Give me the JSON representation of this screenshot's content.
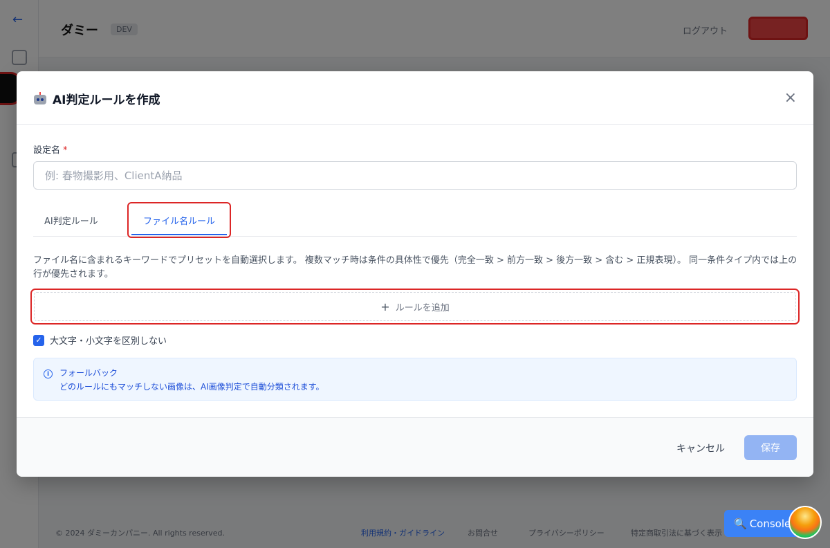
{
  "background": {
    "back_arrow": "←",
    "title": "ダミー",
    "badge": "DEV",
    "header_link": "ログアウト",
    "footer_copy": "© 2024 ダミーカンパニー. All rights reserved.",
    "footer_links": [
      "利用規約・ガイドライン",
      "お問合せ",
      "プライバシーポリシー",
      "特定商取引法に基づく表示"
    ]
  },
  "modal": {
    "title": "AI判定ルールを作成",
    "close_icon": "×",
    "name_field": {
      "label": "設定名",
      "required_mark": "*",
      "placeholder": "例: 春物撮影用、ClientA納品",
      "value": ""
    },
    "tabs": [
      {
        "label": "AI判定ルール",
        "active": false
      },
      {
        "label": "ファイル名ルール",
        "active": true
      }
    ],
    "description": "ファイル名に含まれるキーワードでプリセットを自動選択します。 複数マッチ時は条件の具体性で優先（完全一致 > 前方一致 > 後方一致 > 含む > 正規表現）。 同一条件タイプ内では上の行が優先されます。",
    "add_rule": {
      "icon": "+",
      "label": "ルールを追加"
    },
    "case_insensitive": {
      "label": "大文字・小文字を区別しない",
      "checked": true
    },
    "fallback": {
      "icon": "i",
      "title": "フォールバック",
      "text": "どのルールにもマッチしない画像は、AI画像判定で自動分類されます。"
    },
    "footer": {
      "cancel_label": "キャンセル",
      "save_label": "保存"
    }
  },
  "console": {
    "icon": "🔍",
    "label": "Console"
  },
  "colors": {
    "accent": "#2563eb",
    "highlight": "#dc2626",
    "save_disabled": "#93b4f3",
    "fallback_bg": "#eff6ff"
  }
}
